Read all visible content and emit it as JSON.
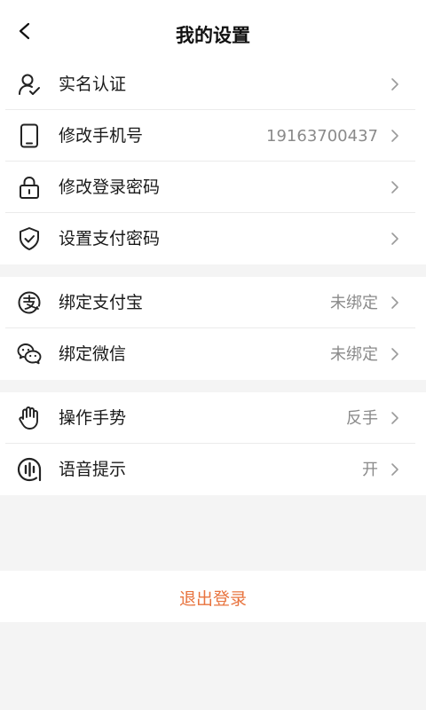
{
  "header": {
    "title": "我的设置"
  },
  "groups": [
    {
      "items": [
        {
          "label": "实名认证",
          "value": "",
          "icon": "user-verify-icon"
        },
        {
          "label": "修改手机号",
          "value": "19163700437",
          "icon": "phone-icon"
        },
        {
          "label": "修改登录密码",
          "value": "",
          "icon": "lock-icon"
        },
        {
          "label": "设置支付密码",
          "value": "",
          "icon": "shield-check-icon"
        }
      ]
    },
    {
      "items": [
        {
          "label": "绑定支付宝",
          "value": "未绑定",
          "icon": "alipay-icon"
        },
        {
          "label": "绑定微信",
          "value": "未绑定",
          "icon": "wechat-icon"
        }
      ]
    },
    {
      "items": [
        {
          "label": "操作手势",
          "value": "反手",
          "icon": "hand-icon"
        },
        {
          "label": "语音提示",
          "value": "开",
          "icon": "voice-icon"
        }
      ]
    }
  ],
  "logout": {
    "label": "退出登录"
  },
  "colors": {
    "accent": "#ef6a35",
    "logout_text": "#e8743f",
    "background": "#f4f4f4"
  }
}
